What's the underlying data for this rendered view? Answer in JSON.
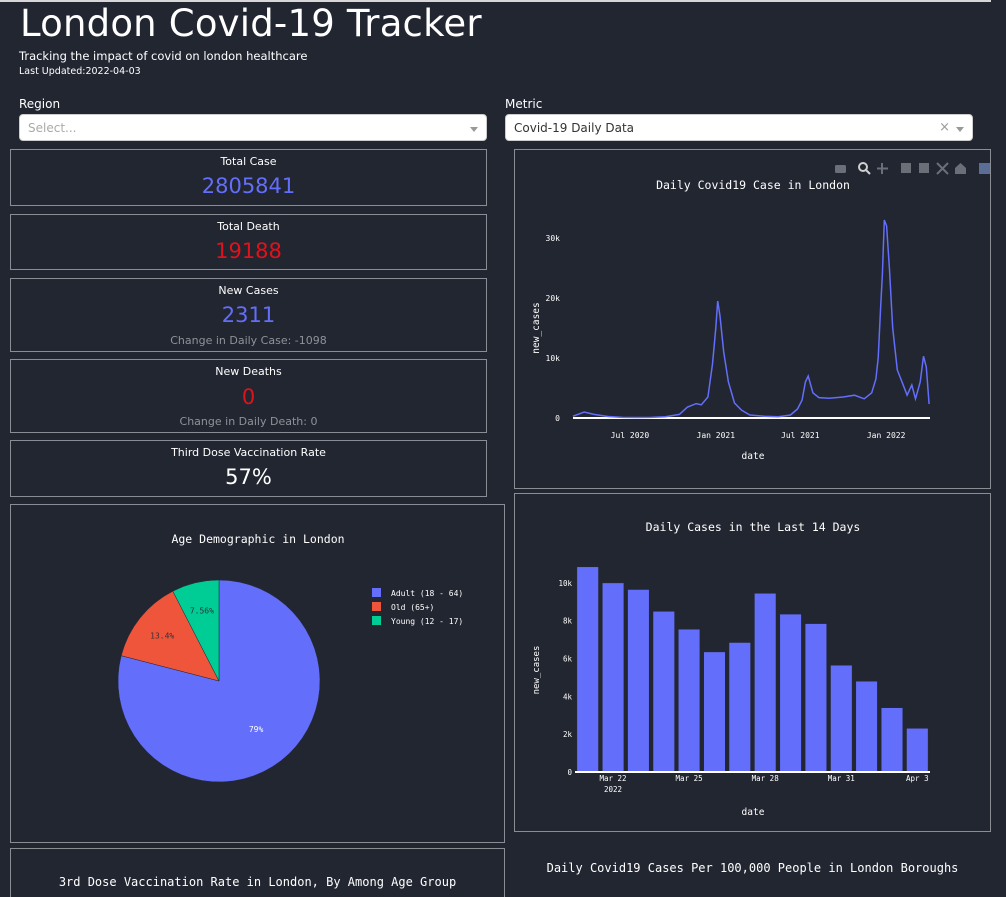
{
  "header": {
    "title": "London Covid-19 Tracker",
    "subtitle": "Tracking the impact of covid on london healthcare",
    "last_updated_label": "Last Updated:",
    "last_updated_value": "2022-04-03"
  },
  "filters": {
    "region_label": "Region",
    "region_placeholder": "Select...",
    "metric_label": "Metric",
    "metric_value": "Covid-19 Daily Data",
    "clear_glyph": "×"
  },
  "stats": {
    "total_case": {
      "label": "Total Case",
      "value": "2805841",
      "color": "#636efa"
    },
    "total_death": {
      "label": "Total Death",
      "value": "19188",
      "color": "#e0121b"
    },
    "new_cases": {
      "label": "New Cases",
      "value": "2311",
      "change": "Change in Daily Case: -1098",
      "color": "#636efa"
    },
    "new_deaths": {
      "label": "New Deaths",
      "value": "0",
      "change": "Change in Daily Death: 0",
      "color": "#e0121b"
    },
    "third_dose": {
      "label": "Third Dose Vaccination Rate",
      "value": "57%"
    }
  },
  "toolbar_icons": [
    "camera-icon",
    "zoom-icon",
    "pan-icon",
    "zoom-in-icon",
    "zoom-out-icon",
    "autoscale-icon",
    "reset-axes-icon",
    "plotly-logo-icon"
  ],
  "chart_data": [
    {
      "type": "line",
      "title": "Daily Covid19 Case in London",
      "xlabel": "date",
      "ylabel": "new_cases",
      "x_ticks": [
        "Jul 2020",
        "Jan 2021",
        "Jul 2021",
        "Jan 2022"
      ],
      "y_ticks": [
        "0",
        "10k",
        "20k",
        "30k"
      ],
      "ylim": [
        0,
        33000
      ],
      "color": "#636efa",
      "series": [
        {
          "x": [
            "2020-03-01",
            "2020-03-25",
            "2020-04-15",
            "2020-05-15",
            "2020-06-15",
            "2020-07-15",
            "2020-08-15",
            "2020-09-15",
            "2020-10-15",
            "2020-11-01",
            "2020-11-20",
            "2020-12-01",
            "2020-12-15",
            "2020-12-25",
            "2021-01-01",
            "2021-01-05",
            "2021-01-10",
            "2021-01-18",
            "2021-01-28",
            "2021-02-10",
            "2021-02-25",
            "2021-03-15",
            "2021-04-15",
            "2021-05-15",
            "2021-06-10",
            "2021-06-25",
            "2021-07-05",
            "2021-07-12",
            "2021-07-18",
            "2021-07-28",
            "2021-08-10",
            "2021-09-01",
            "2021-10-01",
            "2021-10-25",
            "2021-11-15",
            "2021-12-01",
            "2021-12-10",
            "2021-12-15",
            "2021-12-20",
            "2021-12-24",
            "2021-12-28",
            "2022-01-02",
            "2022-01-08",
            "2022-01-15",
            "2022-01-25",
            "2022-02-05",
            "2022-02-15",
            "2022-02-25",
            "2022-03-05",
            "2022-03-15",
            "2022-03-22",
            "2022-03-28",
            "2022-04-03"
          ],
          "y": [
            300,
            1000,
            600,
            250,
            100,
            80,
            100,
            200,
            600,
            1800,
            2400,
            2200,
            3500,
            9000,
            15000,
            19500,
            17000,
            11000,
            6000,
            2500,
            1300,
            500,
            300,
            200,
            500,
            1500,
            3000,
            6000,
            7000,
            4200,
            3400,
            3300,
            3500,
            3800,
            3200,
            4200,
            6500,
            10000,
            18000,
            24000,
            33000,
            32000,
            25000,
            15000,
            8000,
            5800,
            3800,
            5500,
            3200,
            6000,
            10300,
            8500,
            2311
          ]
        }
      ]
    },
    {
      "type": "pie",
      "title": "Age Demographic in London",
      "labels": [
        "Adult (18 - 64)",
        "Old (65+)",
        "Young (12 - 17)"
      ],
      "values": [
        79,
        13.4,
        7.56
      ],
      "text": [
        "79%",
        "13.4%",
        "7.56%"
      ],
      "colors": [
        "#636efa",
        "#ef553b",
        "#00cc96"
      ],
      "legend_placement": "right"
    },
    {
      "type": "bar",
      "title": "Daily Cases in the Last 14 Days",
      "xlabel": "date",
      "ylabel": "new_cases",
      "x_ticks": [
        "Mar 22",
        "Mar 25",
        "Mar 28",
        "Mar 31",
        "Apr 3"
      ],
      "x_tick_year": "2022",
      "y_ticks": [
        "0",
        "2k",
        "4k",
        "6k",
        "8k",
        "10k"
      ],
      "ylim": [
        0,
        11000
      ],
      "color": "#636efa",
      "categories": [
        "2022-03-21",
        "2022-03-22",
        "2022-03-23",
        "2022-03-24",
        "2022-03-25",
        "2022-03-26",
        "2022-03-27",
        "2022-03-28",
        "2022-03-29",
        "2022-03-30",
        "2022-03-31",
        "2022-04-01",
        "2022-04-02",
        "2022-04-03"
      ],
      "values": [
        10850,
        10000,
        9650,
        8500,
        7550,
        6350,
        6850,
        9450,
        8350,
        7850,
        5650,
        4800,
        3400,
        2311
      ]
    }
  ],
  "bottom_titles": {
    "vaccination": "3rd Dose Vaccination Rate in London, By Among Age Group",
    "boroughs": "Daily Covid19 Cases Per 100,000 People in London Boroughs"
  }
}
